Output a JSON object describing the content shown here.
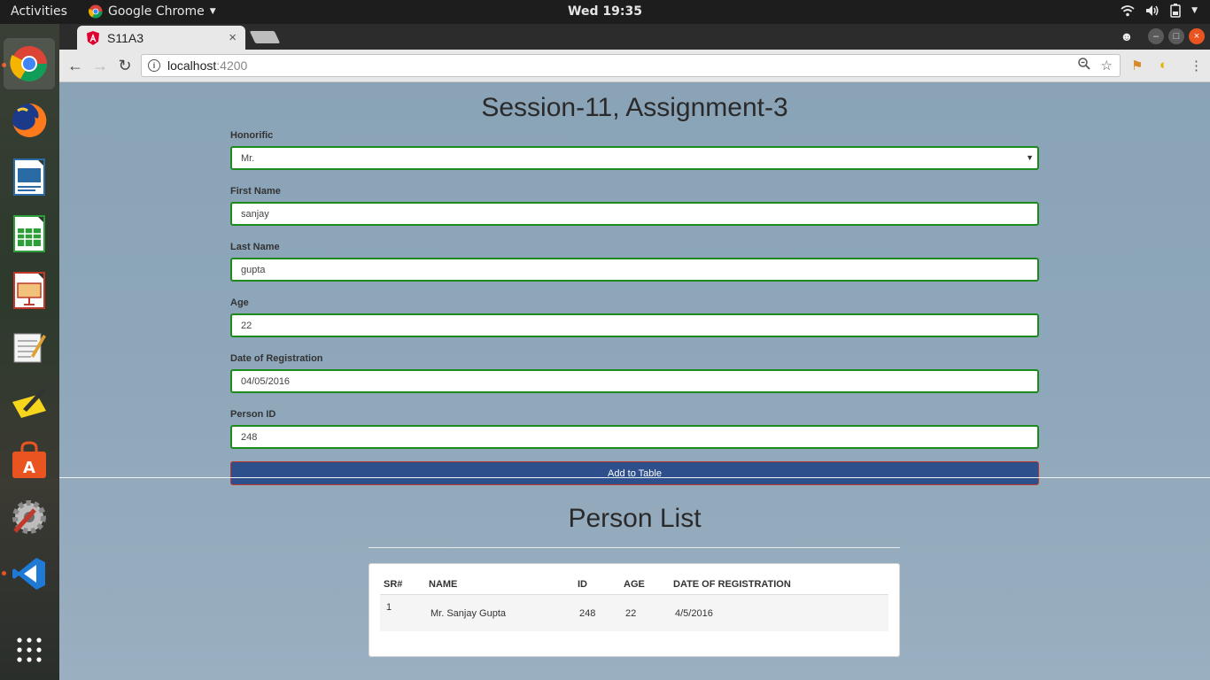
{
  "topbar": {
    "activities": "Activities",
    "app_name": "Google Chrome",
    "clock": "Wed 19:35"
  },
  "dock": {
    "items": [
      "chrome-icon",
      "firefox-icon",
      "libreoffice-writer-icon",
      "libreoffice-calc-icon",
      "libreoffice-impress-icon",
      "text-editor-icon",
      "notes-icon",
      "software-center-icon",
      "settings-icon",
      "vscode-icon",
      "show-apps-icon"
    ]
  },
  "browser": {
    "tab_title": "S11A3",
    "tab_close": "×",
    "url_host": "localhost",
    "url_port": ":4200"
  },
  "page": {
    "title": "Session-11, Assignment-3",
    "form": {
      "honorific_label": "Honorific",
      "honorific_value": "Mr.",
      "first_name_label": "First Name",
      "first_name_value": "sanjay",
      "last_name_label": "Last Name",
      "last_name_value": "gupta",
      "age_label": "Age",
      "age_value": "22",
      "date_label": "Date of Registration",
      "date_value": "04/05/2016",
      "person_id_label": "Person ID",
      "person_id_value": "248",
      "submit_label": "Add to Table"
    },
    "list_title": "Person List",
    "table": {
      "headers": [
        "SR#",
        "NAME",
        "ID",
        "AGE",
        "DATE OF REGISTRATION"
      ],
      "rows": [
        [
          "1",
          "Mr. Sanjay Gupta",
          "248",
          "22",
          "4/5/2016"
        ]
      ]
    }
  },
  "colors": {
    "field_border": "#1d8a1d",
    "button_bg": "#2d4f8c",
    "page_bg": "#8aa3b7"
  }
}
